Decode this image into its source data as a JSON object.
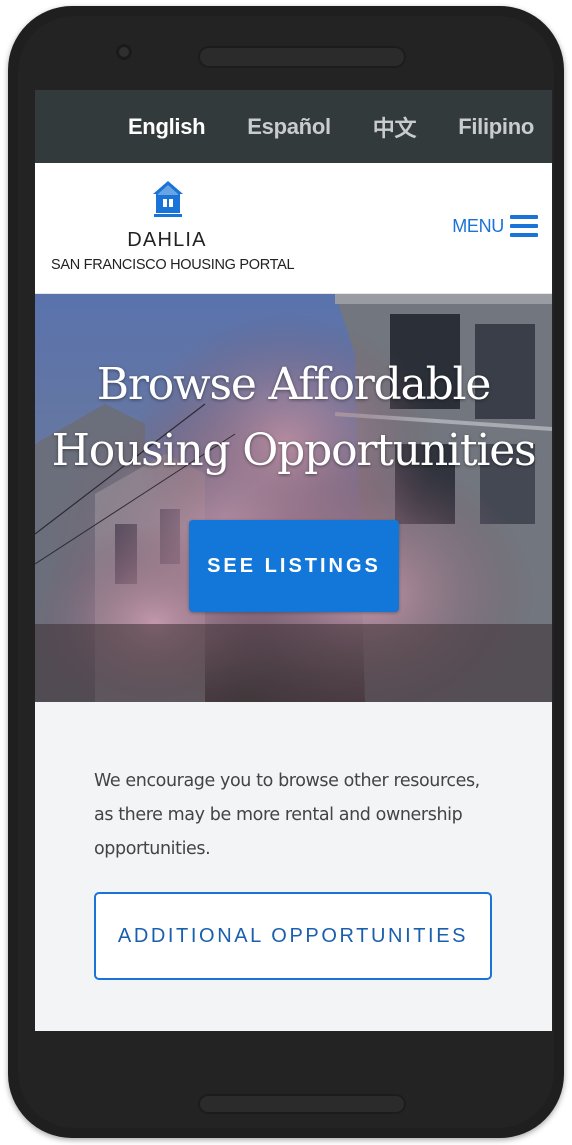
{
  "languages": [
    {
      "label": "English",
      "active": true
    },
    {
      "label": "Español",
      "active": false
    },
    {
      "label": "中文",
      "active": false
    },
    {
      "label": "Filipino",
      "active": false
    }
  ],
  "header": {
    "logo_icon": "house-icon",
    "brand_name": "DAHLIA",
    "brand_subtitle": "SAN FRANCISCO HOUSING PORTAL",
    "menu_label": "MENU",
    "menu_icon": "hamburger-menu-icon"
  },
  "hero": {
    "title_line1": "Browse Affordable",
    "title_line2": "Housing Opportunities",
    "cta_label": "SEE LISTINGS"
  },
  "resources": {
    "text": "We encourage you to browse other resources, as there may be more rental and ownership opportunities.",
    "button_label": "ADDITIONAL OPPORTUNITIES"
  },
  "colors": {
    "accent": "#1377d9",
    "lang_bar": "#333a3c",
    "page_bg": "#f2f4f5"
  }
}
